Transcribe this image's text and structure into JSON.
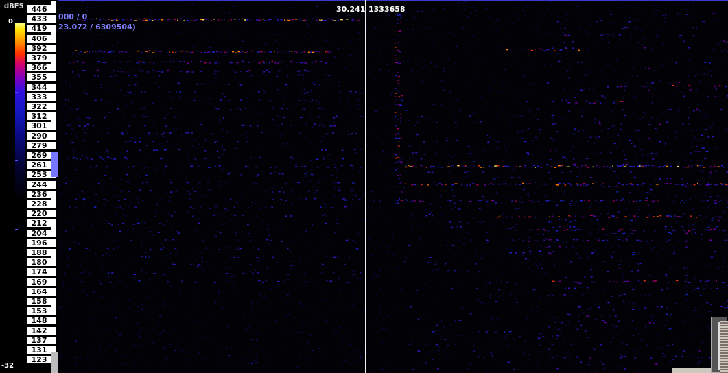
{
  "scale": {
    "title": "dBFS",
    "top_value": "0",
    "bottom_value": "-32",
    "ticks_ratio": [
      0.2,
      0.4,
      0.6,
      0.8
    ]
  },
  "keys": [
    {
      "label": "446",
      "marker": true
    },
    {
      "label": "433",
      "marker": false
    },
    {
      "label": "419",
      "marker": false
    },
    {
      "label": "406",
      "marker": true
    },
    {
      "label": "392",
      "marker": false
    },
    {
      "label": "379",
      "marker": false
    },
    {
      "label": "366",
      "marker": true
    },
    {
      "label": "355",
      "marker": false
    },
    {
      "label": "344",
      "marker": false
    },
    {
      "label": "333",
      "marker": false
    },
    {
      "label": "322",
      "marker": false
    },
    {
      "label": "312",
      "marker": false
    },
    {
      "label": "301",
      "marker": true
    },
    {
      "label": "290",
      "marker": false
    },
    {
      "label": "279",
      "marker": false
    },
    {
      "label": "269",
      "marker": false
    },
    {
      "label": "261",
      "marker": false
    },
    {
      "label": "253",
      "marker": false
    },
    {
      "label": "244",
      "marker": false
    },
    {
      "label": "236",
      "marker": false
    },
    {
      "label": "228",
      "marker": true
    },
    {
      "label": "220",
      "marker": false
    },
    {
      "label": "212",
      "marker": false
    },
    {
      "label": "204",
      "marker": true
    },
    {
      "label": "196",
      "marker": false
    },
    {
      "label": "188",
      "marker": false
    },
    {
      "label": "180",
      "marker": true
    },
    {
      "label": "174",
      "marker": false
    },
    {
      "label": "169",
      "marker": false
    },
    {
      "label": "164",
      "marker": false
    },
    {
      "label": "158",
      "marker": false
    },
    {
      "label": "153",
      "marker": true
    },
    {
      "label": "148",
      "marker": false
    },
    {
      "label": "142",
      "marker": false
    },
    {
      "label": "137",
      "marker": false
    },
    {
      "label": "131",
      "marker": false
    },
    {
      "label": "123",
      "marker": false
    }
  ],
  "readouts": {
    "selection": "000 / 0",
    "range": "23.072 / 6309504)",
    "time": "30.241",
    "sample": "1333658"
  },
  "colors": {
    "accent_blue": "#7777ff",
    "cursor": "#f0f0f0"
  }
}
